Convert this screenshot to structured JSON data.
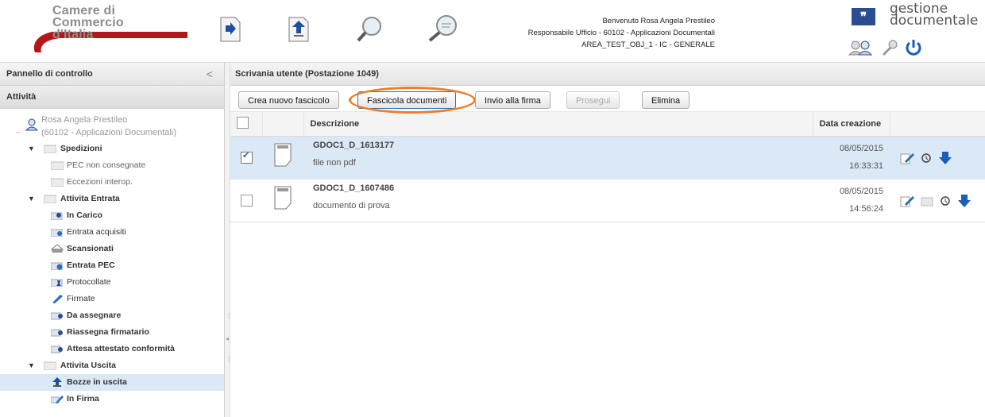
{
  "header": {
    "logo_line1": "Camere di Commercio",
    "logo_line2": "d'Italia",
    "welcome_line1": "Benvenuto Rosa Angela Prestileo",
    "welcome_line2": "Responsabile Ufficio - 60102 - Applicazioni Documentali",
    "welcome_line3": "AREA_TEST_OBJ_1 - IC - GENERALE",
    "brand_symbol": "❞",
    "brand_line1": "gestione",
    "brand_line2": "documentale",
    "toolbar_icons": [
      "import-document-icon",
      "upload-document-icon",
      "search-icon",
      "advanced-search-icon"
    ]
  },
  "left_panel": {
    "title": "Pannello di controllo",
    "collapse_glyph": "<",
    "section": "Attività",
    "user_name": "Rosa Angela Prestileo",
    "user_office": "(60102 - Applicazioni Documentali)",
    "tree": {
      "spedizioni": {
        "label": "Spedizioni",
        "children": [
          "PEC non consegnate",
          "Eccezioni interop."
        ]
      },
      "entrata": {
        "label": "Attivita Entrata",
        "children": [
          "In Carico",
          "Entrata acquisiti",
          "Scansionati",
          "Entrata PEC",
          "Protocollate",
          "Firmate",
          "Da assegnare",
          "Riassegna firmatario",
          "Attesa attestato conformità"
        ]
      },
      "uscita": {
        "label": "Attivita Uscita",
        "children": [
          "Bozze in uscita",
          "In Firma"
        ]
      }
    }
  },
  "main": {
    "title": "Scrivania utente (Postazione 1049)",
    "buttons": {
      "crea": "Crea nuovo fascicolo",
      "fascicola": "Fascicola documenti",
      "invio": "Invio alla firma",
      "prosegui": "Prosegui",
      "elimina": "Elimina"
    },
    "columns": {
      "descrizione": "Descrizione",
      "data": "Data creazione"
    },
    "rows": [
      {
        "title": "GDOC1_D_1613177",
        "desc": "file non pdf",
        "date": "08/05/2015",
        "time": "16:33:31",
        "checked": true
      },
      {
        "title": "GDOC1_D_1607486",
        "desc": "documento di prova",
        "date": "08/05/2015",
        "time": "14:56:24",
        "checked": false
      }
    ]
  },
  "colors": {
    "accent_red": "#b8151b",
    "selection": "#dbe8f5",
    "highlight_ring": "#ee7d2a",
    "brand_blue": "#2a4d8f"
  }
}
